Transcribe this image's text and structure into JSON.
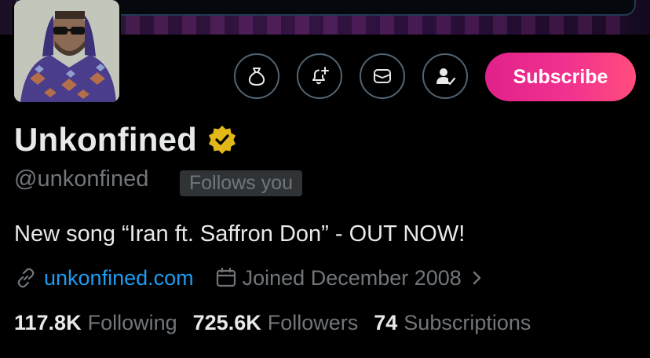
{
  "profile": {
    "name": "Unkonfined",
    "handle": "@unkonfined",
    "follows_you": "Follows you",
    "bio": "New song “Iran ft. Saffron Don” - OUT NOW!",
    "website": "unkonfined.com",
    "joined": "Joined December 2008"
  },
  "actions": {
    "tip_icon": "money-bag-icon",
    "notify_icon": "bell-plus-icon",
    "message_icon": "envelope-icon",
    "following_icon": "person-check-icon",
    "subscribe_label": "Subscribe"
  },
  "stats": {
    "following_count": "117.8K",
    "following_label": "Following",
    "followers_count": "725.6K",
    "followers_label": "Followers",
    "subscriptions_count": "74",
    "subscriptions_label": "Subscriptions"
  },
  "colors": {
    "background": "#000000",
    "text_primary": "#e7e9ea",
    "text_secondary": "#71767b",
    "link": "#1d9bf0",
    "verified_badge": "#e2b719",
    "subscribe_gradient_start": "#e0218a",
    "subscribe_gradient_end": "#ff4d7d"
  }
}
